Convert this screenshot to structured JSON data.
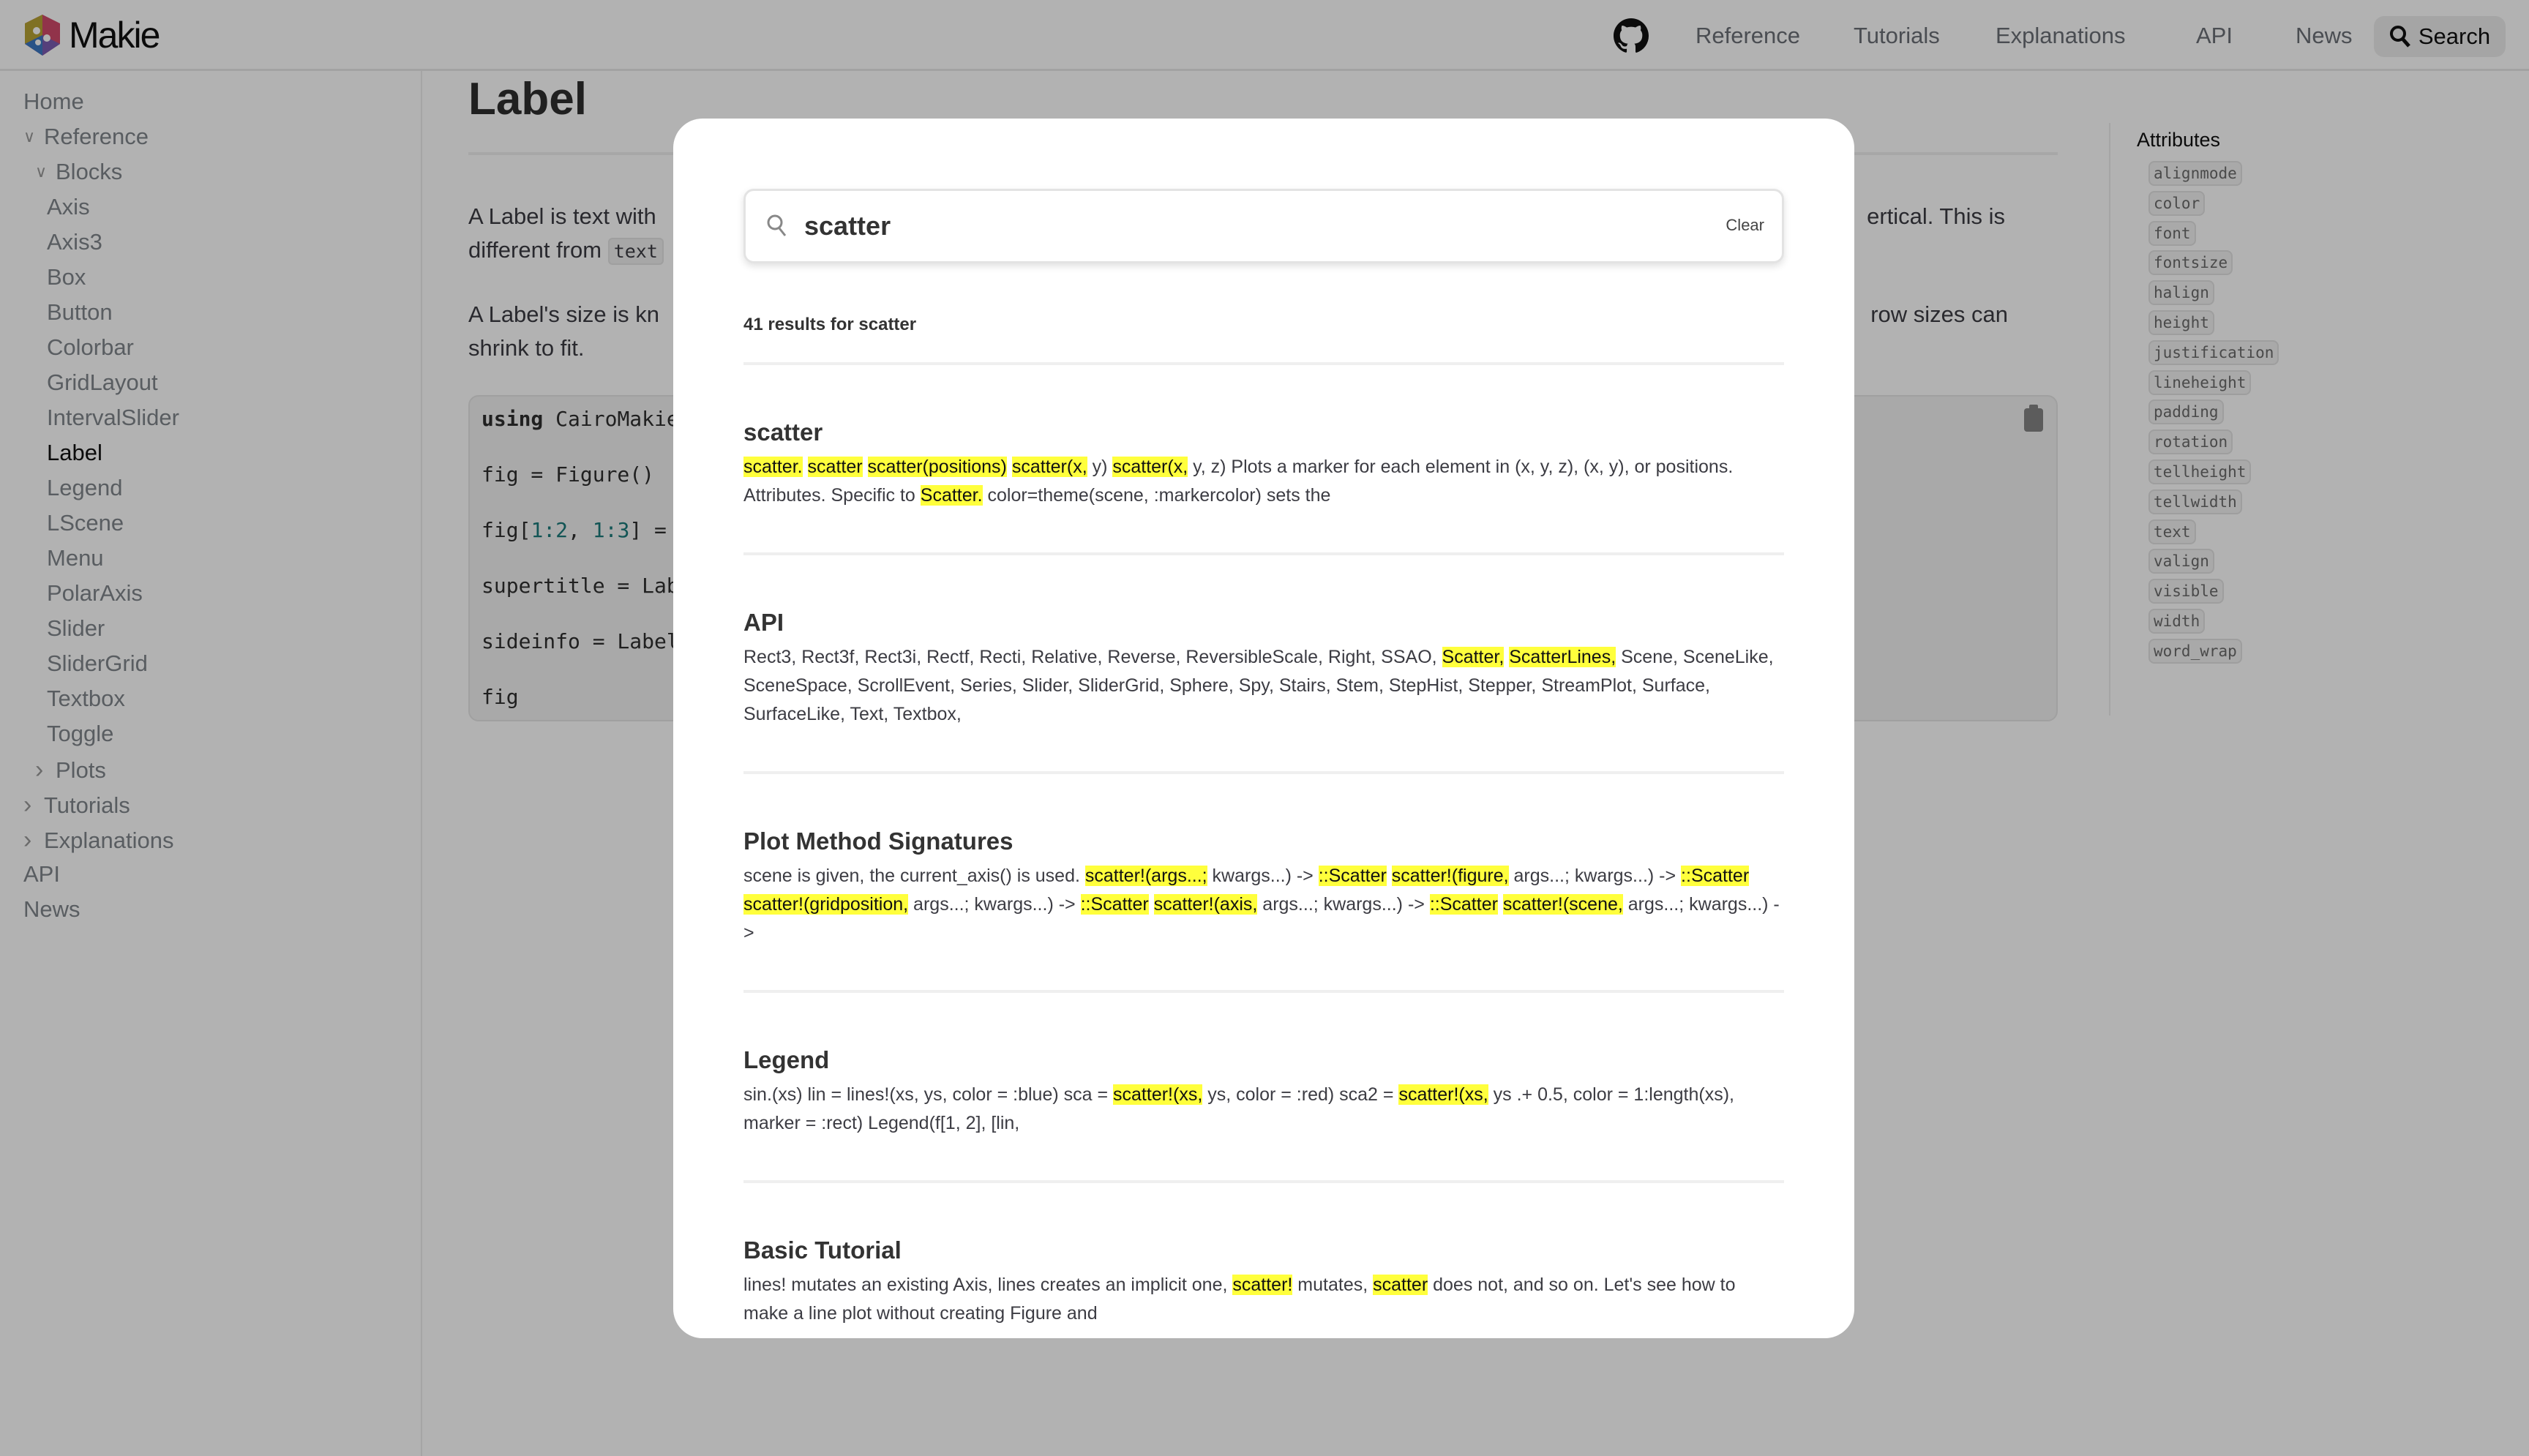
{
  "header": {
    "logo_text": "Makie",
    "nav": [
      "Reference",
      "Tutorials",
      "Explanations",
      "API",
      "News"
    ],
    "search_label": "Search"
  },
  "sidebar": {
    "items": [
      {
        "label": "Home",
        "level": 0,
        "chevron": ""
      },
      {
        "label": "Reference",
        "level": 0,
        "chevron": "down"
      },
      {
        "label": "Blocks",
        "level": 1,
        "chevron": "down"
      },
      {
        "label": "Axis",
        "level": 2
      },
      {
        "label": "Axis3",
        "level": 2
      },
      {
        "label": "Box",
        "level": 2
      },
      {
        "label": "Button",
        "level": 2
      },
      {
        "label": "Colorbar",
        "level": 2
      },
      {
        "label": "GridLayout",
        "level": 2
      },
      {
        "label": "IntervalSlider",
        "level": 2
      },
      {
        "label": "Label",
        "level": 2,
        "active": true
      },
      {
        "label": "Legend",
        "level": 2
      },
      {
        "label": "LScene",
        "level": 2
      },
      {
        "label": "Menu",
        "level": 2
      },
      {
        "label": "PolarAxis",
        "level": 2
      },
      {
        "label": "Slider",
        "level": 2
      },
      {
        "label": "SliderGrid",
        "level": 2
      },
      {
        "label": "Textbox",
        "level": 2
      },
      {
        "label": "Toggle",
        "level": 2
      },
      {
        "label": "Plots",
        "level": 1,
        "chevron": "right"
      },
      {
        "label": "Tutorials",
        "level": 0,
        "chevron": "right"
      },
      {
        "label": "Explanations",
        "level": 0,
        "chevron": "right"
      },
      {
        "label": "API",
        "level": 0,
        "chevron": ""
      },
      {
        "label": "News",
        "level": 0,
        "chevron": ""
      }
    ]
  },
  "main": {
    "title": "Label",
    "p1_left_a": "A Label is text with",
    "p1_left_b": "different from",
    "p1_code": "text",
    "p1_right": "ertical. This is",
    "p2_left_a": "A Label's size is kn",
    "p2_left_b": "shrink to fit.",
    "p2_right": "row sizes can",
    "code": {
      "l1_kw": "using",
      "l1": " CairoMakie",
      "l2": "fig = Figure()",
      "l3_a": "fig[",
      "l3_n1": "1:2",
      "l3_b": ", ",
      "l3_n2": "1:3",
      "l3_c": "] =",
      "l4": "supertitle = Lab",
      "l5": "sideinfo = Label",
      "l6": "fig"
    }
  },
  "toc": {
    "title": "Attributes",
    "items": [
      "alignmode",
      "color",
      "font",
      "fontsize",
      "halign",
      "height",
      "justification",
      "lineheight",
      "padding",
      "rotation",
      "tellheight",
      "tellwidth",
      "text",
      "valign",
      "visible",
      "width",
      "word_wrap"
    ]
  },
  "search_modal": {
    "query": "scatter",
    "clear_label": "Clear",
    "result_count": "41 results for scatter",
    "highlight_color": "#ffff3c",
    "results": [
      {
        "title": "scatter",
        "segments": [
          {
            "t": "scatter.",
            "h": true
          },
          {
            "t": " "
          },
          {
            "t": "scatter",
            "h": true
          },
          {
            "t": " "
          },
          {
            "t": "scatter(positions)",
            "h": true
          },
          {
            "t": " "
          },
          {
            "t": "scatter(x,",
            "h": true
          },
          {
            "t": " y) "
          },
          {
            "t": "scatter(x,",
            "h": true
          },
          {
            "t": " y, z) Plots a marker for each element in (x, y, z), (x, y), or positions. Attributes. Specific to "
          },
          {
            "t": "Scatter.",
            "h": true
          },
          {
            "t": " color=theme(scene, :markercolor) sets the"
          }
        ]
      },
      {
        "title": "API",
        "segments": [
          {
            "t": "Rect3, Rect3f, Rect3i, Rectf, Recti, Relative, Reverse, ReversibleScale, Right, SSAO, "
          },
          {
            "t": "Scatter,",
            "h": true
          },
          {
            "t": " "
          },
          {
            "t": "ScatterLines,",
            "h": true
          },
          {
            "t": " Scene, SceneLike, SceneSpace, ScrollEvent, Series, Slider, SliderGrid, Sphere, Spy, Stairs, Stem, StepHist, Stepper, StreamPlot, Surface, SurfaceLike, Text, Textbox,"
          }
        ]
      },
      {
        "title": "Plot Method Signatures",
        "segments": [
          {
            "t": "scene is given, the current_axis() is used. "
          },
          {
            "t": "scatter!(args...;",
            "h": true
          },
          {
            "t": " kwargs...) -> "
          },
          {
            "t": "::Scatter",
            "h": true
          },
          {
            "t": " "
          },
          {
            "t": "scatter!(figure,",
            "h": true
          },
          {
            "t": " args...; kwargs...) -> "
          },
          {
            "t": "::Scatter",
            "h": true
          },
          {
            "t": " "
          },
          {
            "t": "scatter!(gridposition,",
            "h": true
          },
          {
            "t": " args...; kwargs...) -> "
          },
          {
            "t": "::Scatter",
            "h": true
          },
          {
            "t": " "
          },
          {
            "t": "scatter!(axis,",
            "h": true
          },
          {
            "t": " args...; kwargs...) -> "
          },
          {
            "t": "::Scatter",
            "h": true
          },
          {
            "t": " "
          },
          {
            "t": "scatter!(scene,",
            "h": true
          },
          {
            "t": " args...; kwargs...) ->"
          }
        ]
      },
      {
        "title": "Legend",
        "segments": [
          {
            "t": "sin.(xs) lin = lines!(xs, ys, color = :blue) sca = "
          },
          {
            "t": "scatter!(xs,",
            "h": true
          },
          {
            "t": " ys, color = :red) sca2 = "
          },
          {
            "t": "scatter!(xs,",
            "h": true
          },
          {
            "t": " ys .+ 0.5, color = 1:length(xs), marker = :rect) Legend(f[1, 2], [lin,"
          }
        ]
      },
      {
        "title": "Basic Tutorial",
        "segments": [
          {
            "t": "lines! mutates an existing Axis, lines creates an implicit one, "
          },
          {
            "t": "scatter!",
            "h": true
          },
          {
            "t": " mutates, "
          },
          {
            "t": "scatter",
            "h": true
          },
          {
            "t": " does not, and so on. Let's see how to make a line plot without creating Figure and"
          }
        ]
      }
    ]
  }
}
